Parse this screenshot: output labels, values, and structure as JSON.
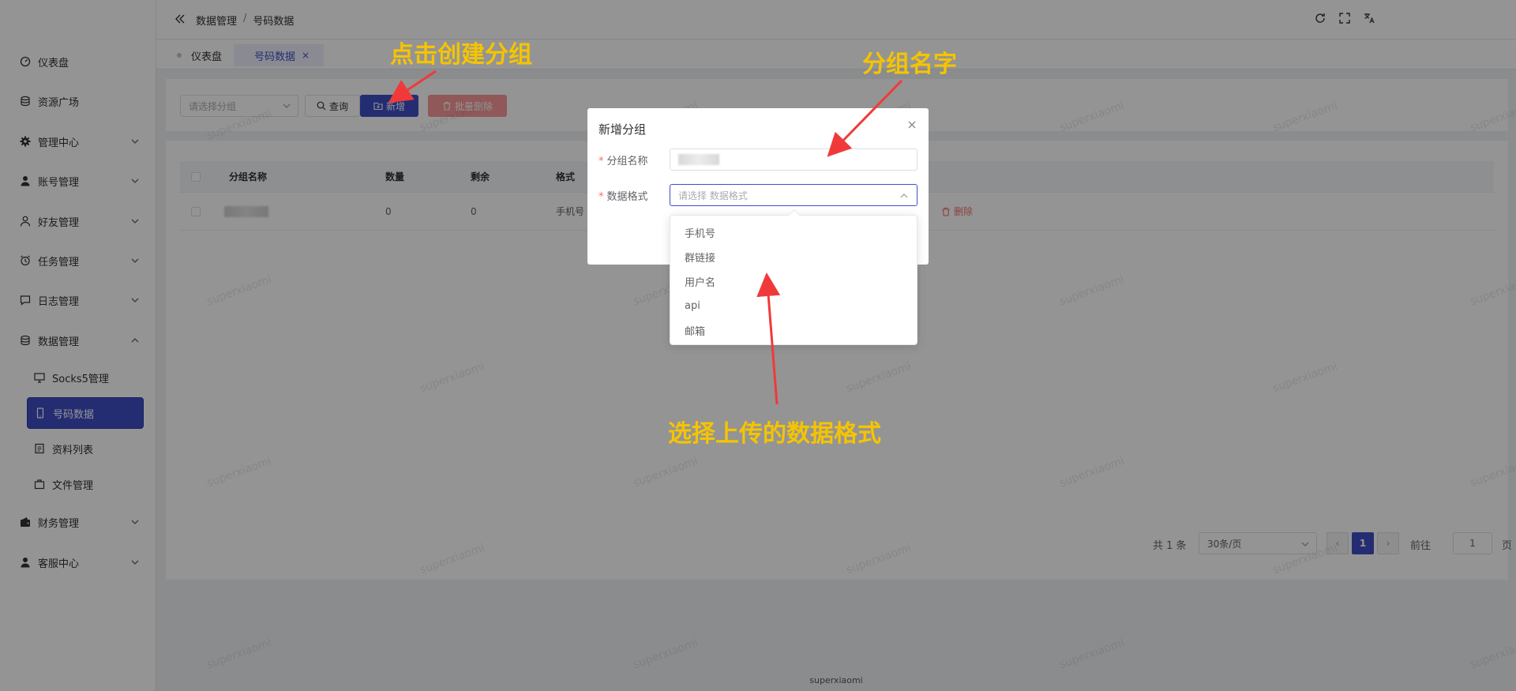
{
  "breadcrumb": [
    "数据管理",
    "号码数据"
  ],
  "breadcrumb_sep": "/",
  "sidebar": {
    "items": [
      {
        "label": "仪表盘",
        "icon": "dashboard-icon"
      },
      {
        "label": "资源广场",
        "icon": "database-icon"
      },
      {
        "label": "管理中心",
        "icon": "gear-icon"
      },
      {
        "label": "账号管理",
        "icon": "user-icon"
      },
      {
        "label": "好友管理",
        "icon": "user-outline-icon"
      },
      {
        "label": "任务管理",
        "icon": "alarm-clock-icon"
      },
      {
        "label": "日志管理",
        "icon": "chat-bubble-icon"
      },
      {
        "label": "数据管理",
        "icon": "database-icon"
      },
      {
        "label": "财务管理",
        "icon": "wallet-icon"
      },
      {
        "label": "客服中心",
        "icon": "user-icon"
      }
    ],
    "subitems": [
      {
        "label": "Socks5管理",
        "icon": "monitor-icon"
      },
      {
        "label": "号码数据",
        "icon": "phone-icon"
      },
      {
        "label": "资料列表",
        "icon": "document-icon"
      },
      {
        "label": "文件管理",
        "icon": "suitcase-icon"
      }
    ]
  },
  "tabs": [
    {
      "label": "仪表盘"
    },
    {
      "label": "号码数据",
      "close": "×"
    }
  ],
  "toolbar": {
    "group_placeholder": "请选择分组",
    "query_label": "查询",
    "add_label": "新增",
    "batch_delete_label": "批量删除"
  },
  "table": {
    "headers": [
      "分组名称",
      "数量",
      "剩余",
      "格式"
    ],
    "rows": [
      {
        "count": "0",
        "remaining": "0",
        "format": "手机号",
        "action": "删除"
      }
    ]
  },
  "pagination": {
    "total": "共 1 条",
    "page_size": "30条/页",
    "prev": "‹",
    "current": "1",
    "next": "›",
    "goto_label": "前往",
    "goto_value": "1",
    "page_unit": "页"
  },
  "dialog": {
    "title": "新增分组",
    "close": "×",
    "name_label": "分组名称",
    "format_label": "数据格式",
    "format_placeholder": "请选择 数据格式",
    "required_mark": "*"
  },
  "dropdown": {
    "options": [
      "手机号",
      "群链接",
      "用户名",
      "api",
      "邮箱"
    ]
  },
  "watermark": "superxiaomi",
  "footer": "superxiaomi",
  "annotations": {
    "click_create": "点击创建分组",
    "group_name": "分组名字",
    "select_format": "选择上传的数据格式"
  },
  "colors": {
    "primary": "#3f4fc5",
    "danger": "#f56c6c",
    "annotation_text": "#f5c400",
    "annotation_arrow": "#f03a3a"
  }
}
